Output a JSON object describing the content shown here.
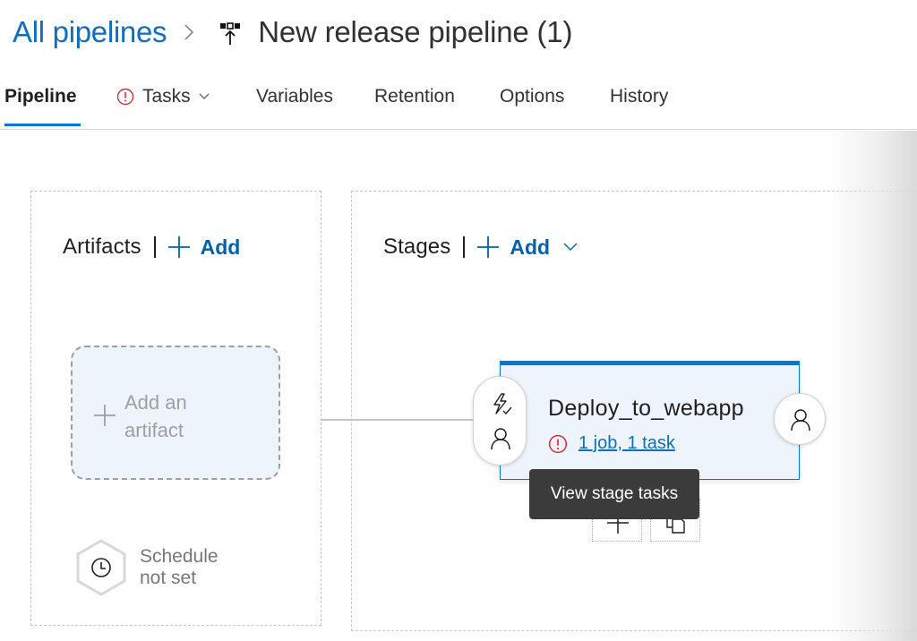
{
  "header": {
    "breadcrumb_link": "All pipelines",
    "separator_icon": "chevron-right-icon",
    "pipeline_icon": "release-pipeline-icon",
    "title": "New release pipeline (1)"
  },
  "tabs": [
    {
      "label": "Pipeline",
      "active": true
    },
    {
      "label": "Tasks",
      "has_error": true,
      "has_dropdown": true
    },
    {
      "label": "Variables"
    },
    {
      "label": "Retention"
    },
    {
      "label": "Options"
    },
    {
      "label": "History"
    }
  ],
  "artifacts": {
    "title": "Artifacts",
    "add_label": "Add",
    "placeholder": "Add an artifact",
    "schedule_label_line1": "Schedule",
    "schedule_label_line2": "not set"
  },
  "stages": {
    "title": "Stages",
    "add_label": "Add",
    "items": [
      {
        "name": "Deploy_to_webapp",
        "summary": "1 job, 1 task",
        "has_error": true,
        "pre_deployment_icons": [
          "trigger-icon",
          "pre-approval-user-icon"
        ],
        "post_deployment_icon": "post-approval-user-icon"
      }
    ]
  },
  "tooltip": "View stage tasks",
  "colors": {
    "accent": "#0078d4",
    "link": "#106ebe",
    "error": "#d13438",
    "card_bg": "#eef4fb"
  }
}
